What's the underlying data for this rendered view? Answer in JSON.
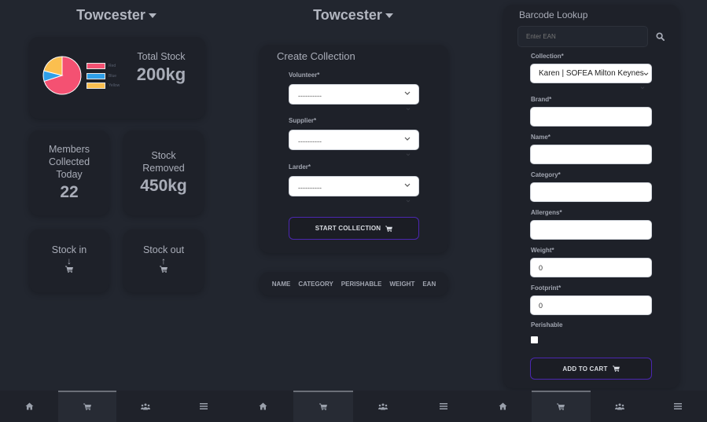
{
  "location": "Towcester",
  "screen1": {
    "chart_data": {
      "type": "pie",
      "labels": [
        "Red",
        "Blue",
        "Yellow"
      ],
      "values": [
        70,
        9,
        21
      ],
      "colors": [
        "#f45172",
        "#2f9fe8",
        "#fbbf4f"
      ],
      "legend": "right"
    },
    "total_stock": {
      "label": "Total Stock",
      "value": "200kg"
    },
    "members": {
      "label_lines": [
        "Members",
        "Collected",
        "Today"
      ],
      "value": "22"
    },
    "removed": {
      "label_lines": [
        "Stock",
        "Removed"
      ],
      "value": "450kg"
    },
    "stock_in": {
      "label": "Stock in",
      "arrow": "↓",
      "icon": "cart-icon"
    },
    "stock_out": {
      "label": "Stock out",
      "arrow": "↑",
      "icon": "cart-icon"
    }
  },
  "screen2": {
    "title": "Create Collection",
    "fields": [
      {
        "label": "Volunteer*",
        "value": "----------"
      },
      {
        "label": "Supplier*",
        "value": "----------"
      },
      {
        "label": "Larder*",
        "value": "----------"
      }
    ],
    "start_button": "START COLLECTION",
    "table_headers": [
      "NAME",
      "CATEGORY",
      "PERISHABLE",
      "WEIGHT",
      "EAN"
    ]
  },
  "screen3": {
    "title": "Barcode Lookup",
    "ean_placeholder": "Enter EAN",
    "collection": {
      "label": "Collection*",
      "value": "Karen | SOFEA Milton Keynes"
    },
    "fields": [
      {
        "label": "Brand*",
        "value": ""
      },
      {
        "label": "Name*",
        "value": ""
      },
      {
        "label": "Category*",
        "value": ""
      },
      {
        "label": "Allergens*",
        "value": ""
      },
      {
        "label": "Weight*",
        "value": "0"
      },
      {
        "label": "Footprint*",
        "value": "0"
      }
    ],
    "perishable_label": "Perishable",
    "perishable_checked": false,
    "add_button": "ADD TO CART"
  },
  "nav": {
    "items": [
      {
        "name": "home",
        "icon": "home-icon"
      },
      {
        "name": "cart",
        "icon": "cart-icon",
        "active": true
      },
      {
        "name": "users",
        "icon": "users-icon"
      },
      {
        "name": "menu",
        "icon": "menu-icon"
      }
    ]
  },
  "colors": {
    "background": "#22262f",
    "card": "#1e2129",
    "accent_border": "#4b27b0",
    "text": "#a9adb8"
  }
}
